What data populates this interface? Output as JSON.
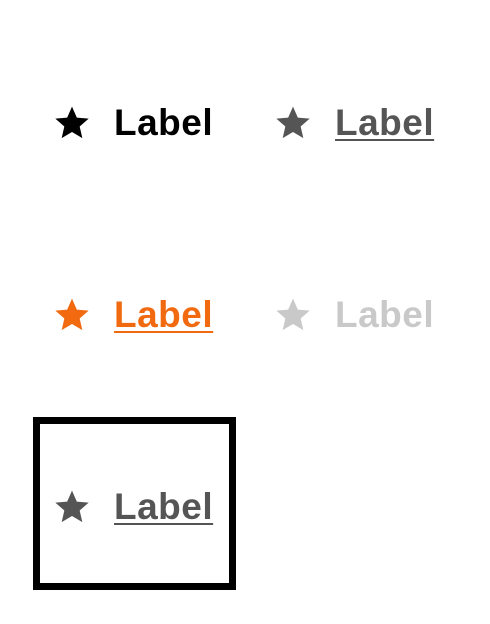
{
  "links": [
    {
      "id": "default",
      "label": "Label",
      "icon": "star-icon",
      "state": "default",
      "color": "#000000",
      "underlined": false
    },
    {
      "id": "hover",
      "label": "Label",
      "icon": "star-icon",
      "state": "hover",
      "color": "#555555",
      "underlined": true
    },
    {
      "id": "active",
      "label": "Label",
      "icon": "star-icon",
      "state": "active",
      "color": "#f26a10",
      "underlined": true
    },
    {
      "id": "disabled",
      "label": "Label",
      "icon": "star-icon",
      "state": "disabled",
      "color": "#c9c9c9",
      "underlined": false
    },
    {
      "id": "focus",
      "label": "Label",
      "icon": "star-icon",
      "state": "focus",
      "color": "#555555",
      "underlined": true
    }
  ],
  "colors": {
    "default": "#000000",
    "hover": "#555555",
    "active": "#f26a10",
    "disabled": "#c9c9c9",
    "focus_ring": "#000000",
    "background": "#ffffff"
  }
}
